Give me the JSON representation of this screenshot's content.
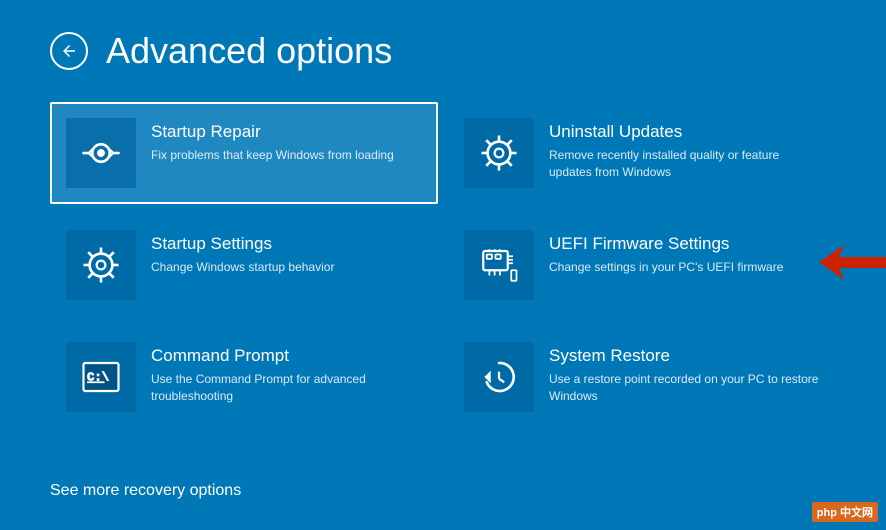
{
  "page": {
    "title": "Advanced options",
    "back_label": "back"
  },
  "options": [
    {
      "id": "startup-repair",
      "title": "Startup Repair",
      "description": "Fix problems that keep Windows from loading",
      "icon": "repair",
      "selected": true
    },
    {
      "id": "uninstall-updates",
      "title": "Uninstall Updates",
      "description": "Remove recently installed quality or feature updates from Windows",
      "icon": "gear",
      "selected": false
    },
    {
      "id": "startup-settings",
      "title": "Startup Settings",
      "description": "Change Windows startup behavior",
      "icon": "gear",
      "selected": false
    },
    {
      "id": "uefi-firmware",
      "title": "UEFI Firmware Settings",
      "description": "Change settings in your PC's UEFI firmware",
      "icon": "uefi",
      "selected": false
    },
    {
      "id": "command-prompt",
      "title": "Command Prompt",
      "description": "Use the Command Prompt for advanced troubleshooting",
      "icon": "cmd",
      "selected": false
    },
    {
      "id": "system-restore",
      "title": "System Restore",
      "description": "Use a restore point recorded on your PC to restore Windows",
      "icon": "restore",
      "selected": false
    }
  ],
  "footer": {
    "see_more_label": "See more recovery options"
  },
  "watermark": {
    "text": "php 中文网"
  }
}
